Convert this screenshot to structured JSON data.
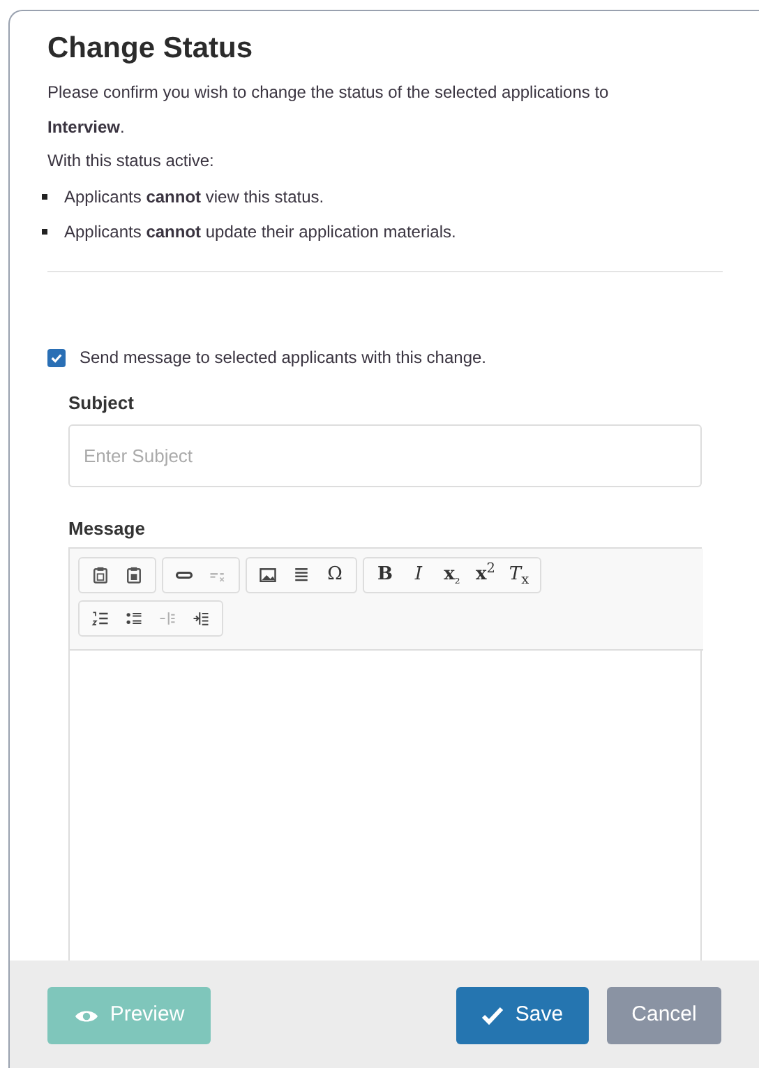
{
  "dialog": {
    "title": "Change Status",
    "intro": "Please confirm you wish to change the status of the selected applications to **Interview**.",
    "lead": "With this status active:",
    "bullets": [
      "Applicants **cannot** view this status.",
      "Applicants **cannot** update their application materials."
    ],
    "send_message": {
      "label": "Send message to selected applicants with this change.",
      "checked": true
    },
    "subject": {
      "label": "Subject",
      "placeholder": "Enter Subject"
    },
    "message": {
      "label": "Message",
      "toolbar": [
        [
          {
            "kind": "paste",
            "disabled": false
          },
          {
            "kind": "paste-word",
            "disabled": false
          }
        ],
        [
          {
            "kind": "link",
            "disabled": false
          },
          {
            "kind": "unlink",
            "disabled": true
          }
        ],
        [
          {
            "kind": "image",
            "disabled": false
          },
          {
            "kind": "rule",
            "disabled": false
          },
          {
            "kind": "text",
            "label": "Ω",
            "disabled": false
          }
        ],
        [
          {
            "kind": "text",
            "label": "**B**",
            "disabled": false
          },
          {
            "kind": "text",
            "label": "*I*",
            "disabled": false
          },
          {
            "kind": "text",
            "label": "**x**$_{₂}$",
            "disabled": false
          },
          {
            "kind": "text",
            "label": "**x**$^{2}$",
            "disabled": false
          },
          {
            "kind": "text",
            "label": "*T*$_{x}$",
            "disabled": false
          }
        ],
        [
          {
            "kind": "numbered-list",
            "disabled": false
          },
          {
            "kind": "bulleted-list",
            "disabled": false
          },
          {
            "kind": "outdent",
            "disabled": true
          },
          {
            "kind": "indent",
            "disabled": false
          }
        ]
      ]
    },
    "buttons": [
      {
        "kind": "preview",
        "label": "Preview",
        "disabled": true
      },
      {
        "kind": "save",
        "label": "Save",
        "disabled": false
      },
      {
        "kind": "cancel",
        "label": "Cancel",
        "disabled": false
      }
    ]
  }
}
